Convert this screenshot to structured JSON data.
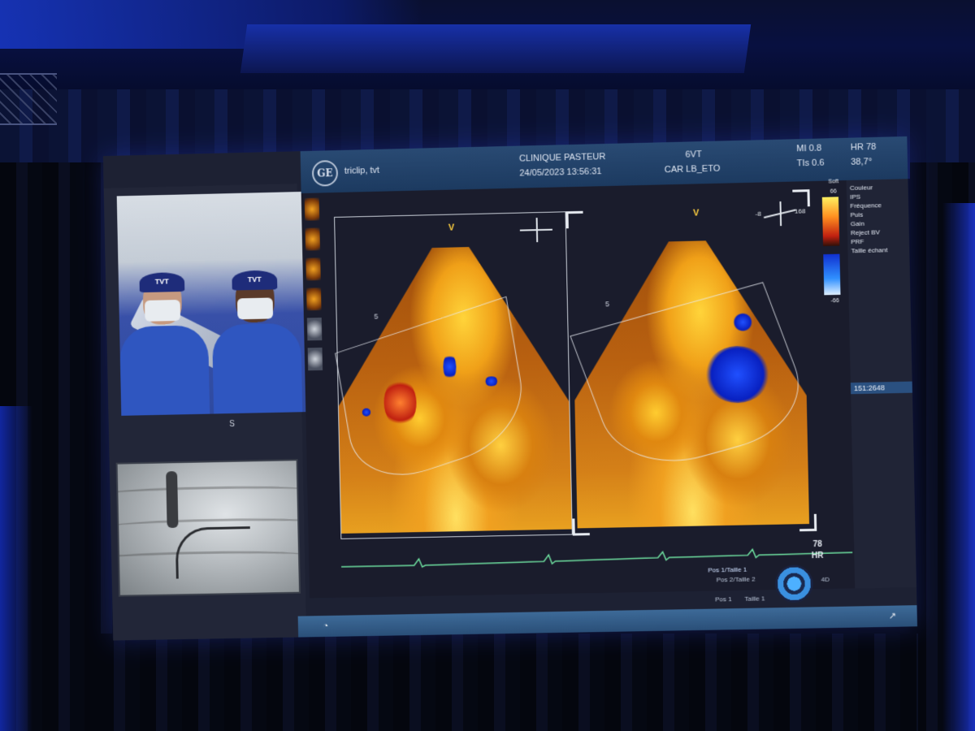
{
  "header": {
    "user_tags": "triclip, tvt",
    "clinic": "CLINIQUE PASTEUR",
    "datetime": "24/05/2023 13:56:31",
    "probe": "6VT",
    "preset": "CAR  LB_ETO",
    "mi": "MI 0.8",
    "tis": "TIs 0.6",
    "hr": "HR 78",
    "temp": "38,7°",
    "logo_text": "GE"
  },
  "video": {
    "label": "S",
    "cap_text": "TVT"
  },
  "views": {
    "orientation_marker": "V",
    "depth_label": "5",
    "angle_label": "168",
    "angle_label_neg": "-8"
  },
  "side_panel": {
    "color_label": "Couleur",
    "params": [
      "IPS",
      "Fréquence",
      "Puis",
      "Gain",
      "Reject BV",
      "PRF",
      "Taille échant"
    ],
    "map_label": "Soft",
    "scale_top": "66",
    "scale_bottom": "-66",
    "depth_readout": "151:2648"
  },
  "ecg": {
    "hr_value": "78",
    "hr_label": "HR"
  },
  "probe_controls": {
    "pos1_taille1": "Pos 1/Taille 1",
    "pos2_taille2": "Pos 2/Taille 2",
    "pos1": "Pos 1",
    "taille1": "Taille 1",
    "mode": "4D"
  },
  "icons": [
    "ge-logo",
    "dpad-icon",
    "taskbar-app-icon",
    "taskbar-exit-icon"
  ],
  "colors": {
    "header_bg": "#294a73",
    "taskbar_bg": "#3d6a98",
    "ultrasound_gold": "#f0a018",
    "doppler_blue": "#2050ff",
    "ecg_green": "#6ee0a0"
  }
}
